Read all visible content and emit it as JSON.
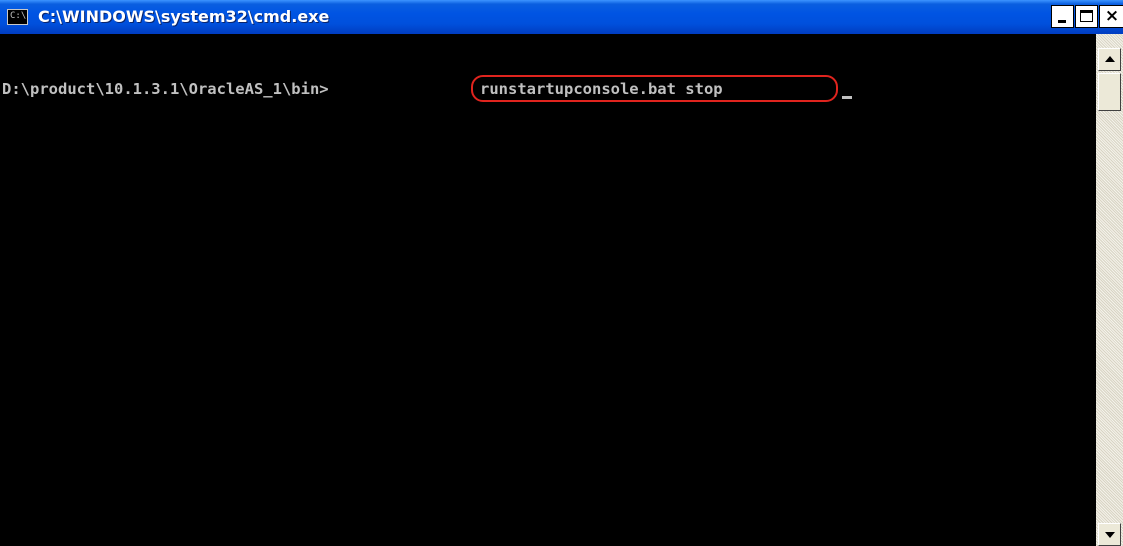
{
  "window": {
    "title": "C:\\WINDOWS\\system32\\cmd.exe",
    "icon": "cmd-icon",
    "icon_text": "C:\\"
  },
  "titlebar_buttons": {
    "minimize_icon": "minimize-icon",
    "maximize_icon": "maximize-icon",
    "close_icon": "close-icon",
    "close_glyph": "×"
  },
  "console": {
    "prompt": "D:\\product\\10.1.3.1\\OracleAS_1\\bin>",
    "command": "runstartupconsole.bat stop",
    "text_color": "#c0c0c0",
    "background_color": "#000000",
    "highlight_color": "#e0241e"
  },
  "scrollbar": {
    "up_icon": "scroll-up-arrow-icon",
    "down_icon": "scroll-down-arrow-icon"
  },
  "colors": {
    "titlebar": "#0054e3",
    "title_text": "#ffffff"
  }
}
